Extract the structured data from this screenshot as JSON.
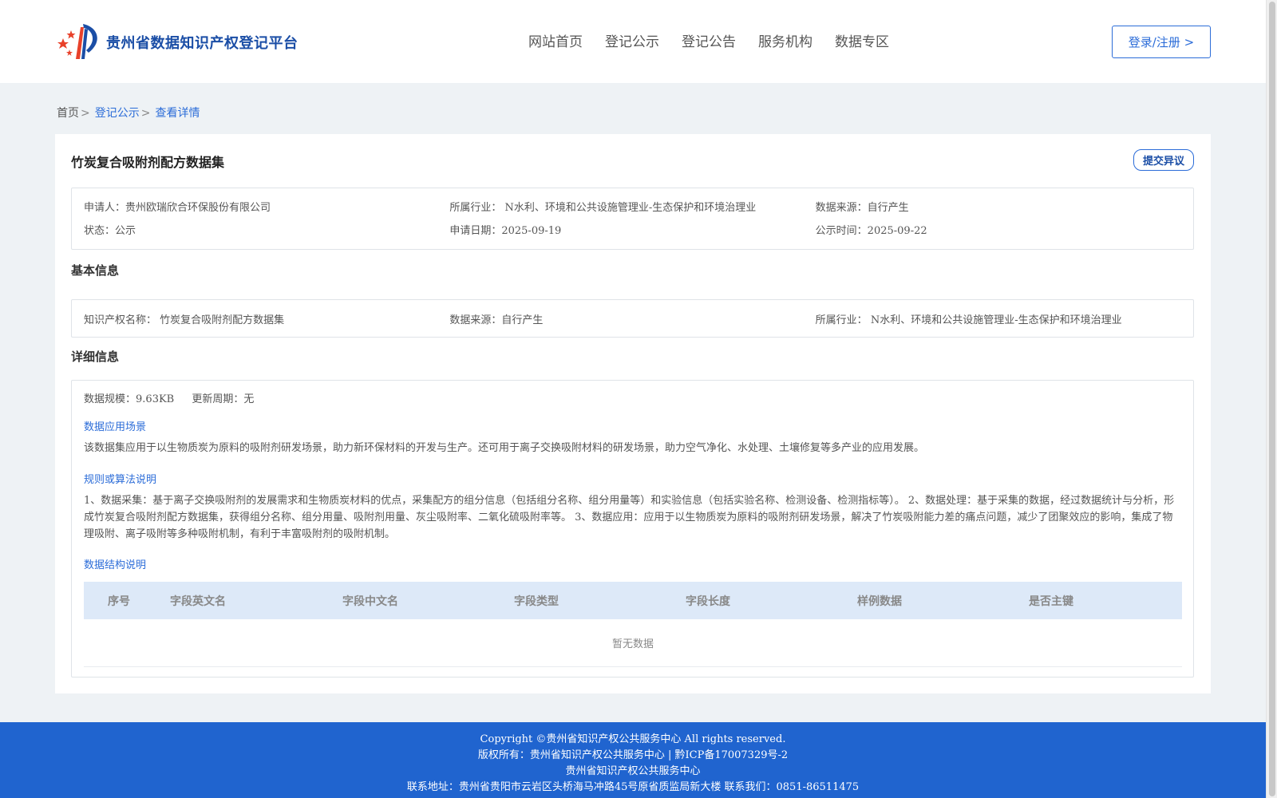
{
  "header": {
    "site_title": "贵州省数据知识产权登记平台",
    "nav": [
      "网站首页",
      "登记公示",
      "登记公告",
      "服务机构",
      "数据专区"
    ],
    "login_label": "登录/注册 >"
  },
  "breadcrumb": {
    "home": "首页",
    "sep": ">",
    "item1": "登记公示",
    "item2": "查看详情"
  },
  "record": {
    "title": "竹炭复合吸附剂配方数据集",
    "objection_label": "提交异议",
    "summary": {
      "applicant_label": "申请人：",
      "applicant": "贵州欧瑞欣合环保股份有限公司",
      "industry_label": "所属行业：",
      "industry": "N水利、环境和公共设施管理业-生态保护和环境治理业",
      "source_label": "数据来源：",
      "source": "自行产生",
      "status_label": "状态：",
      "status": "公示",
      "apply_date_label": "申请日期：",
      "apply_date": "2025-09-19",
      "publish_date_label": "公示时间：",
      "publish_date": "2025-09-22"
    },
    "basic": {
      "section_title": "基本信息",
      "ip_name_label": "知识产权名称：",
      "ip_name": "竹炭复合吸附剂配方数据集",
      "source_label": "数据来源：",
      "source": "自行产生",
      "industry_label": "所属行业：",
      "industry": "N水利、环境和公共设施管理业-生态保护和环境治理业"
    },
    "detail": {
      "section_title": "详细信息",
      "scale_label": "数据规模：",
      "scale": "9.63KB",
      "cycle_label": "更新周期：",
      "cycle": "无",
      "scenario_title": "数据应用场景",
      "scenario_text": "该数据集应用于以生物质炭为原料的吸附剂研发场景，助力新环保材料的开发与生产。还可用于离子交换吸附材料的研发场景，助力空气净化、水处理、土壤修复等多产业的应用发展。",
      "rules_title": "规则或算法说明",
      "rules_text": "1、数据采集：基于离子交换吸附剂的发展需求和生物质炭材料的优点，采集配方的组分信息（包括组分名称、组分用量等）和实验信息（包括实验名称、检测设备、检测指标等）。 2、数据处理：基于采集的数据，经过数据统计与分析，形成竹炭复合吸附剂配方数据集，获得组分名称、组分用量、吸附剂用量、灰尘吸附率、二氧化硫吸附率等。 3、数据应用：应用于以生物质炭为原料的吸附剂研发场景，解决了竹炭吸附能力差的痛点问题，减少了团聚效应的影响，集成了物理吸附、离子吸附等多种吸附机制，有利于丰富吸附剂的吸附机制。",
      "structure_title": "数据结构说明",
      "table_headers": [
        "序号",
        "字段英文名",
        "字段中文名",
        "字段类型",
        "字段长度",
        "样例数据",
        "是否主键"
      ],
      "empty_text": "暂无数据"
    }
  },
  "footer": {
    "line1": "Copyright ©贵州省知识产权公共服务中心 All rights reserved.",
    "line2": "版权所有：贵州省知识产权公共服务中心 | 黔ICP备17007329号-2",
    "line3": "贵州省知识产权公共服务中心",
    "line4": "联系地址：贵州省贵阳市云岩区头桥海马冲路45号原省质监局新大楼 联系我们：0851-86511475"
  },
  "colors": {
    "accent": "#2b6cd8",
    "footer_bg": "#2064cf",
    "table_head_bg": "#dde9f8",
    "page_bg": "#eef2f5"
  }
}
